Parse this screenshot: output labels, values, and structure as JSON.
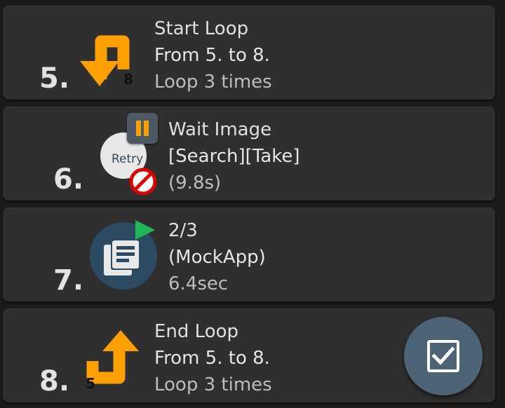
{
  "items": [
    {
      "number": "5.",
      "line1": "Start Loop",
      "line2": "From 5. to 8.",
      "line3": "Loop 3 times",
      "icon": "loop-start-arrow-icon",
      "icon_badge": "8"
    },
    {
      "number": "6.",
      "line1": "Wait Image",
      "line2": "[Search][Take]",
      "line3": "(9.8s)",
      "icon": "retry-icon",
      "icon_label": "Retry"
    },
    {
      "number": "7.",
      "line1": "2/3",
      "line2": "(MockApp)",
      "line3": "6.4sec",
      "icon": "documents-icon"
    },
    {
      "number": "8.",
      "line1": "End Loop",
      "line2": "From 5. to 8.",
      "line3": "Loop 3 times",
      "icon": "loop-end-arrow-icon",
      "icon_badge": "5"
    }
  ],
  "fab": {
    "icon": "checkbox-checked-icon"
  },
  "colors": {
    "background": "#1b1b1b",
    "card": "#2f2f2f",
    "loop_arrow": "#ffa000",
    "stop": "#d50000",
    "play": "#1db954",
    "fab": "#4e6375"
  }
}
